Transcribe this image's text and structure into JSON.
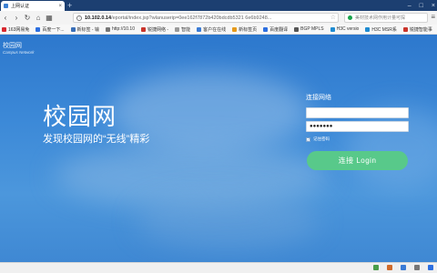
{
  "browser": {
    "tab": {
      "title": "上网认证",
      "close": "×"
    },
    "new_tab": "+",
    "window_buttons": {
      "minimize": "–",
      "maximize": "□",
      "close": "×"
    },
    "nav": {
      "back": "‹",
      "forward": "›",
      "reload": "↻",
      "home": "⌂",
      "apps": "▦"
    },
    "address": {
      "warning": "!",
      "host": "10.102.0.14",
      "path": "/eportal/index.jsp?wlanuserip=0ee162f7872b420bdcdb5321 6e6b9248...",
      "star": "☆"
    },
    "search": {
      "placeholder": "美材技术网作用计量可探"
    },
    "menu": "≡",
    "bookmarks": [
      {
        "label": "163网易免",
        "color": "#d7282f"
      },
      {
        "label": "百度一下...",
        "color": "#2d6fe0"
      },
      {
        "label": "新标签 - 输",
        "color": "#3a6fb7"
      },
      {
        "label": "http://10.10",
        "color": "#777777"
      },
      {
        "label": "锐捷网络 - ",
        "color": "#c9342b"
      },
      {
        "label": "智能",
        "color": "#9a9a9a"
      },
      {
        "label": "客户在在线",
        "color": "#3a7bd5"
      },
      {
        "label": "新标签页",
        "color": "#e59a1c"
      },
      {
        "label": "百度翻译",
        "color": "#2d6fe0"
      },
      {
        "label": "BGP MPLS",
        "color": "#555555"
      },
      {
        "label": "H3C versio",
        "color": "#1f8bd1"
      },
      {
        "label": "H3C MSR系",
        "color": "#1f8bd1"
      },
      {
        "label": "锐捷智能事",
        "color": "#c9342b"
      }
    ]
  },
  "portal": {
    "brand": {
      "name": "校园网",
      "subtitle": "Campus Network"
    },
    "hero": {
      "title": "校园网",
      "subtitle": "发现校园网的“无线”精彩"
    },
    "login": {
      "title": "连接网络",
      "username": "",
      "password": "●●●●●●●",
      "remember_checked": "✓",
      "remember_label": "记住密码",
      "button": "连接 Login"
    }
  },
  "status_colors": [
    "#4a9d4a",
    "#d06b2a",
    "#3a7bd5",
    "#777777",
    "#2d6fe0"
  ]
}
